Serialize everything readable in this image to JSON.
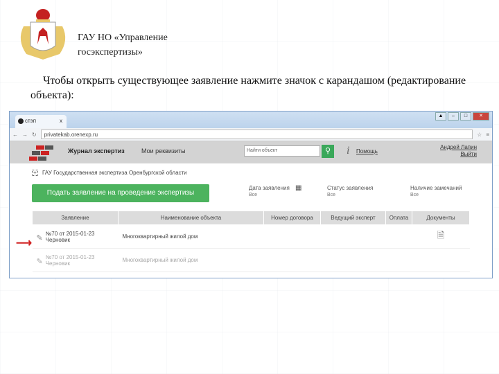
{
  "slide": {
    "org_title": "ГАУ НО «Управление госэкспертизы»",
    "instruction": "Чтобы открыть существующее заявление нажмите значок с карандашом (редактирование объекта):"
  },
  "browser": {
    "tab_title": "стэп",
    "tab_close": "x",
    "url": "privatekab.orenexp.ru",
    "window_buttons": [
      "▲",
      "–",
      "□",
      "✕"
    ]
  },
  "app": {
    "nav": [
      "Журнал экспертиз",
      "Мои реквизиты"
    ],
    "search_placeholder": "Найти объект",
    "help": "Помощь",
    "user_name": "Андрей Лапин",
    "logout": "Выйти",
    "org": "ГАУ Государственная экспертиза Оренбургской области",
    "submit_button": "Подать заявление на проведение экспертизы",
    "filters": [
      {
        "label": "Дата заявления",
        "value": "Все"
      },
      {
        "label": "Статус заявления",
        "value": "Все"
      },
      {
        "label": "Наличие замечаний",
        "value": "Все"
      }
    ],
    "columns": [
      "Заявление",
      "Наименование объекта",
      "Номер договора",
      "Ведущий эксперт",
      "Оплата",
      "Документы"
    ],
    "rows": [
      {
        "app": "№70 от 2015-01-23",
        "status": "Черновик",
        "object": "Многоквартирный жилой дом"
      },
      {
        "app": "№70 от 2015-01-23",
        "status": "Черновик",
        "object": "Многоквартирный жилой дом"
      }
    ]
  },
  "colors": {
    "accent": "#4cb35e",
    "arrow": "#d02020"
  }
}
